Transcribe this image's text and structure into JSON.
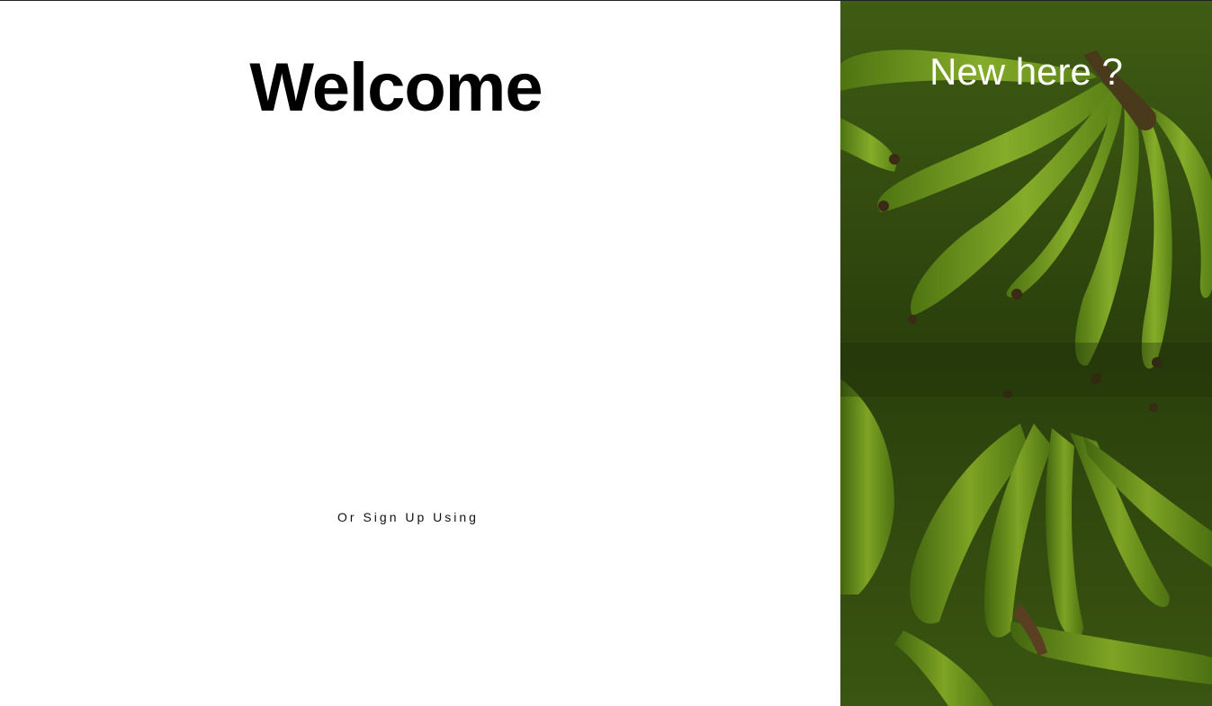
{
  "login": {
    "title": "Welcome",
    "alt_signup_text": "Or Sign Up Using"
  },
  "promo": {
    "heading": "New here ?",
    "background_image": "green-bananas-photo"
  },
  "colors": {
    "background": "#ffffff",
    "title": "#000000",
    "promo_text": "#ffffff",
    "banana_green": "#6f9a1e"
  }
}
